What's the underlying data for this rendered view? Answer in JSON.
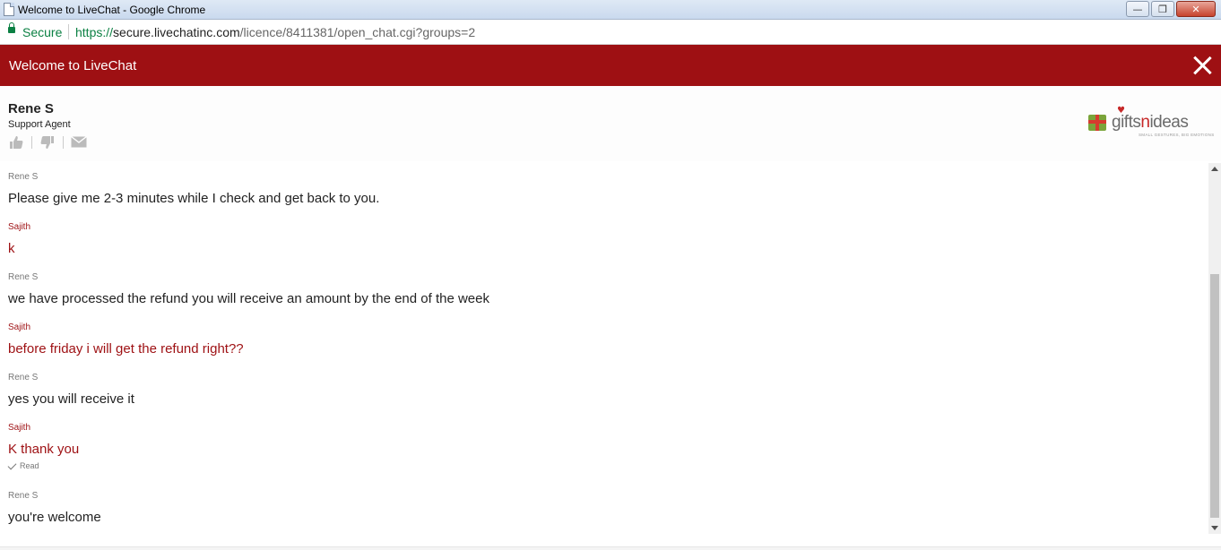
{
  "window": {
    "title": "Welcome to LiveChat - Google Chrome"
  },
  "addressbar": {
    "secure_label": "Secure",
    "url_scheme": "https://",
    "url_host": "secure.livechatinc.com",
    "url_path": "/licence/8411381/open_chat.cgi?groups=2"
  },
  "chat_header": {
    "title": "Welcome to LiveChat"
  },
  "agent": {
    "name": "Rene S",
    "role": "Support Agent"
  },
  "logo": {
    "brand_a": "gifts",
    "brand_n": "n",
    "brand_b": "ideas",
    "tagline": "SMALL GESTURES, BIG EMOTIONS"
  },
  "messages": [
    {
      "sender": "Rene S",
      "text": "Please give me 2-3 minutes while I check and get back to you.",
      "role": "agent"
    },
    {
      "sender": "Sajith",
      "text": "k",
      "role": "visitor"
    },
    {
      "sender": "Rene S",
      "text": "we have processed the refund you will receive an amount by the end of the week",
      "role": "agent"
    },
    {
      "sender": "Sajith",
      "text": "before friday i will get the refund right??",
      "role": "visitor"
    },
    {
      "sender": "Rene S",
      "text": "yes you will receive it",
      "role": "agent"
    },
    {
      "sender": "Sajith",
      "text": "K thank you",
      "role": "visitor",
      "status": "Read"
    },
    {
      "sender": "Rene S",
      "text": "you're welcome",
      "role": "agent"
    }
  ],
  "colors": {
    "brand_red": "#9e1013",
    "secure_green": "#0b8043"
  }
}
